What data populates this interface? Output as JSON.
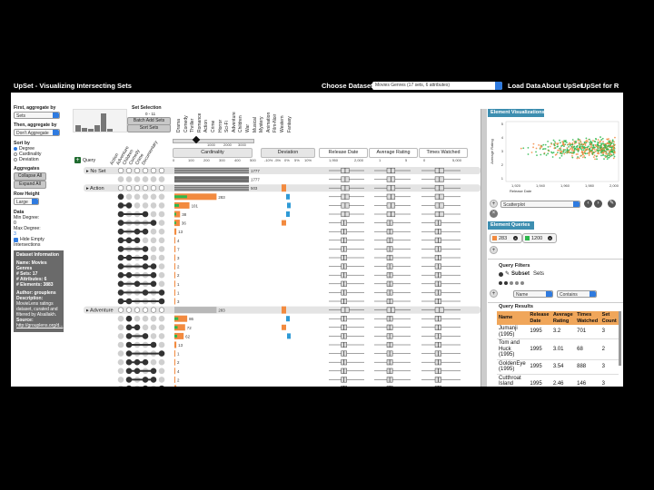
{
  "topbar": {
    "title": "UpSet - Visualizing Intersecting Sets",
    "choose_dataset": "Choose Dataset",
    "dataset_select": "Movies Genres (17 sets, 6 attributes)",
    "load_data": "Load Data",
    "about": "About UpSet",
    "upset_r": "UpSet for R"
  },
  "sidebar": {
    "first_aggregate_label": "First, aggregate by",
    "first_aggregate_value": "Sets",
    "then_aggregate_label": "Then, aggregate by",
    "then_aggregate_value": "Don't Aggregate",
    "sort_by_label": "Sort by",
    "sort_options": [
      "Degree",
      "Cardinality",
      "Deviation"
    ],
    "sort_selected": 0,
    "aggregates_label": "Aggregates",
    "collapse_all": "Collapse All",
    "expand_all": "Expand All",
    "row_height_label": "Row Height",
    "row_height_value": "Large",
    "data_label": "Data",
    "min_degree_label": "Min Degree:",
    "min_degree_value": "0",
    "max_degree_label": "Max Degree:",
    "max_degree_value": "3",
    "hide_empty_label": "Hide Empty",
    "intersections_label": "Intersections",
    "dataset_info": {
      "heading": "Dataset Information",
      "name": "Name: Movies Genres",
      "sets": "# Sets: 17",
      "attributes": "# Attributes: 6",
      "elements": "# Elements: 3883",
      "author": "Author: grouplens",
      "description_label": "Description:",
      "description": "MovieLens ratings dataset, curated and filtered by Alsallakh.",
      "source_label": "Source:",
      "source": "http://grouplens.org/d..."
    }
  },
  "set_selection": {
    "label": "Set Selection",
    "range": "0 - 11",
    "batch_add": "Batch Add Sets",
    "sort_sets": "Sort Sets"
  },
  "set_names": [
    "Drama",
    "Comedy",
    "Thriller",
    "Romance",
    "Action",
    "Crime",
    "Horror",
    "Sci-Fi",
    "Adventure",
    "Children",
    "War",
    "Musical",
    "Mystery",
    "Animation",
    "Film-Noir",
    "Western",
    "Fantasy"
  ],
  "matrix_set_labels": [
    "Action",
    "Adventure",
    "Children",
    "Comedy",
    "Crime",
    "Documentary"
  ],
  "query_label": "Query",
  "columns": {
    "cardinality": "Cardinality",
    "deviation": "Deviation",
    "release_date": "Release Date",
    "avg_rating": "Average Rating",
    "times_watched": "Times Watched"
  },
  "axes": {
    "cardinality_ticks": [
      "0",
      "100",
      "200",
      "300",
      "400",
      "500"
    ],
    "top_slider_ticks": [
      "1000",
      "2000",
      "3000"
    ],
    "deviation_ticks": [
      "-10%",
      "-5%",
      "0%",
      "5%",
      "10%"
    ],
    "release_ticks": [
      "1,950",
      "2,000"
    ],
    "rating_ticks": [
      "1",
      "5"
    ],
    "watched_ticks": [
      "0",
      "5,000"
    ]
  },
  "rows": [
    {
      "type": "group",
      "label": "No Set",
      "count": "1777",
      "value": 1777
    },
    {
      "type": "set",
      "count": "1777",
      "value": 1777,
      "dev": 0,
      "dots": []
    },
    {
      "type": "group",
      "label": "Action",
      "count": "503",
      "value": 503
    },
    {
      "type": "set",
      "count": "283",
      "value": 283,
      "dev": 0,
      "dots": [
        0
      ]
    },
    {
      "type": "set",
      "count": "101",
      "value": 101,
      "dev": 0,
      "dots": [
        0,
        1
      ]
    },
    {
      "type": "set",
      "count": "38",
      "value": 38,
      "dev": 0,
      "dots": [
        0,
        3
      ]
    },
    {
      "type": "set",
      "count": "36",
      "value": 36,
      "dev": 0,
      "dots": [
        0,
        4
      ]
    },
    {
      "type": "set",
      "count": "13",
      "value": 13,
      "dev": 0,
      "dots": [
        0,
        2,
        3
      ]
    },
    {
      "type": "set",
      "count": "4",
      "value": 4,
      "dev": 0,
      "dots": [
        0,
        1,
        2
      ]
    },
    {
      "type": "set",
      "count": "7",
      "value": 7,
      "dev": 0,
      "dots": [
        0,
        3
      ]
    },
    {
      "type": "set",
      "count": "3",
      "value": 3,
      "dev": 0,
      "dots": [
        0,
        1,
        3
      ]
    },
    {
      "type": "set",
      "count": "2",
      "value": 2,
      "dev": 0,
      "dots": [
        0,
        3,
        4
      ]
    },
    {
      "type": "set",
      "count": "2",
      "value": 2,
      "dev": 0,
      "dots": [
        0,
        1,
        4
      ]
    },
    {
      "type": "set",
      "count": "1",
      "value": 1,
      "dev": 0,
      "dots": [
        0,
        2,
        4
      ]
    },
    {
      "type": "set",
      "count": "1",
      "value": 1,
      "dev": 0,
      "dots": [
        0,
        3,
        5
      ]
    },
    {
      "type": "set",
      "count": "3",
      "value": 3,
      "dev": 0,
      "dots": [
        0,
        1,
        5
      ]
    },
    {
      "type": "group",
      "label": "Adventure",
      "count": "283",
      "value": 283
    },
    {
      "type": "set",
      "count": "86",
      "value": 86,
      "dev": 0,
      "dots": [
        1
      ]
    },
    {
      "type": "set",
      "count": "72",
      "value": 72,
      "dev": 0,
      "dots": [
        1,
        2
      ]
    },
    {
      "type": "set",
      "count": "62",
      "value": 62,
      "dev": 0,
      "dots": [
        1,
        3
      ]
    },
    {
      "type": "set",
      "count": "13",
      "value": 13,
      "dev": 0,
      "dots": [
        1,
        4
      ]
    },
    {
      "type": "set",
      "count": "1",
      "value": 1,
      "dev": 0,
      "dots": [
        1,
        5
      ]
    },
    {
      "type": "set",
      "count": "2",
      "value": 2,
      "dev": 0,
      "dots": [
        1,
        2,
        3
      ]
    },
    {
      "type": "set",
      "count": "4",
      "value": 4,
      "dev": 0,
      "dots": [
        1,
        2,
        4
      ]
    },
    {
      "type": "set",
      "count": "2",
      "value": 2,
      "dev": 0,
      "dots": [
        1,
        3,
        4
      ]
    },
    {
      "type": "set",
      "count": "13",
      "value": 13,
      "dev": 0,
      "dots": [
        1,
        3,
        5
      ]
    }
  ],
  "right_panel": {
    "element_viz_label": "Element Visualizations",
    "scatter_y_label": "Average Rating",
    "scatter_x_label": "Release Date",
    "scatter_x_ticks": [
      "1,920",
      "1,940",
      "1,960",
      "1,980",
      "2,000"
    ],
    "scatter_y_ticks": [
      "5",
      "4",
      "3",
      "2",
      "1"
    ],
    "viz_type": "Scatterplot",
    "element_queries_label": "Element Queries",
    "queries": [
      {
        "count": "283",
        "color": "#f28a3f"
      },
      {
        "count": "1200",
        "color": "#2db84d"
      }
    ],
    "query_filters_label": "Query Filters",
    "subset_label": "Subset",
    "sets_label": "Sets",
    "filter_field": "Name",
    "filter_op": "Contains",
    "query_results_label": "Query Results",
    "results_headers": [
      "Name",
      "Release Date",
      "Average Rating",
      "Times Watched",
      "Set Count"
    ],
    "results": [
      [
        "Jumanji (1995)",
        "1995",
        "3.2",
        "701",
        "3"
      ],
      [
        "Tom and Huck (1995)",
        "1995",
        "3.01",
        "68",
        "2"
      ],
      [
        "GoldenEye (1995)",
        "1995",
        "3.54",
        "888",
        "3"
      ],
      [
        "Cutthroat Island (1995)",
        "1995",
        "2.46",
        "146",
        "3"
      ]
    ]
  },
  "colors": {
    "orange": "#f28a3f",
    "blue": "#2f9ad6",
    "green": "#2db84d",
    "gray_bar": "#b8b8b8",
    "panel_header": "#3d8eb0"
  }
}
